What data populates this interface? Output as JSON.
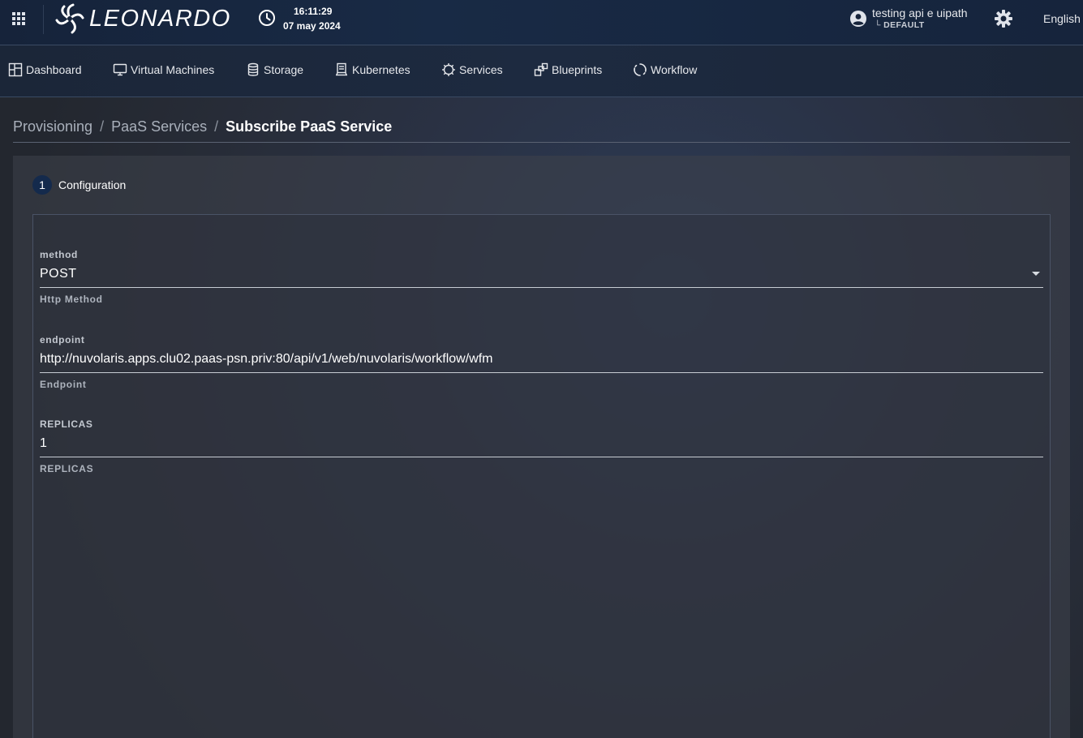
{
  "header": {
    "brand": "LEONARDO",
    "time": "16:11:29",
    "date": "07 may 2024",
    "user_name": "testing api e uipath",
    "user_tenant": "└ DEFAULT",
    "language": "English"
  },
  "nav": {
    "items": [
      {
        "label": "Dashboard",
        "icon": "dashboard-icon"
      },
      {
        "label": "Virtual Machines",
        "icon": "monitor-icon"
      },
      {
        "label": "Storage",
        "icon": "database-icon"
      },
      {
        "label": "Kubernetes",
        "icon": "kubernetes-icon"
      },
      {
        "label": "Services",
        "icon": "gear-icon"
      },
      {
        "label": "Blueprints",
        "icon": "blueprint-icon"
      },
      {
        "label": "Workflow",
        "icon": "workflow-icon"
      }
    ]
  },
  "breadcrumb": {
    "items": [
      "Provisioning",
      "PaaS Services"
    ],
    "current": "Subscribe PaaS Service"
  },
  "stepper": {
    "number": "1",
    "label": "Configuration"
  },
  "form": {
    "fields": [
      {
        "label": "method",
        "value": "POST",
        "help": "Http Method",
        "type": "select"
      },
      {
        "label": "endpoint",
        "value": "http://nuvolaris.apps.clu02.paas-psn.priv:80/api/v1/web/nuvolaris/workflow/wfm",
        "help": "Endpoint",
        "type": "text"
      },
      {
        "label": "REPLICAS",
        "value": "1",
        "help": "REPLICAS",
        "type": "text"
      }
    ]
  }
}
